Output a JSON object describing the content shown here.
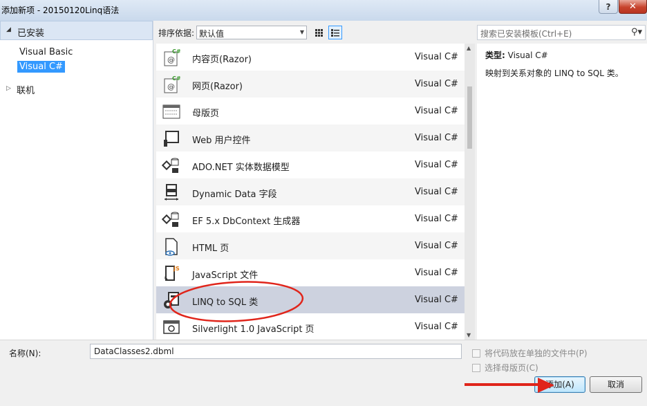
{
  "window": {
    "title": "添加新项 - 20150120Linq语法",
    "help": "?",
    "close": "✕"
  },
  "left": {
    "installed": "已安装",
    "items": [
      {
        "label": "Visual Basic"
      },
      {
        "label": "Visual C#",
        "selected": true
      }
    ],
    "online": "联机"
  },
  "toolbar": {
    "sort_label": "排序依据:",
    "sort_value": "默认值"
  },
  "search": {
    "placeholder": "搜索已安装模板(Ctrl+E)"
  },
  "templates": [
    {
      "name": "内容页(Razor)",
      "lang": "Visual C#",
      "icon": "razor-page-icon"
    },
    {
      "name": "网页(Razor)",
      "lang": "Visual C#",
      "icon": "razor-page-icon"
    },
    {
      "name": "母版页",
      "lang": "Visual C#",
      "icon": "master-page-icon"
    },
    {
      "name": "Web 用户控件",
      "lang": "Visual C#",
      "icon": "user-control-icon"
    },
    {
      "name": "ADO.NET 实体数据模型",
      "lang": "Visual C#",
      "icon": "entity-model-icon"
    },
    {
      "name": "Dynamic Data 字段",
      "lang": "Visual C#",
      "icon": "dynamic-data-icon"
    },
    {
      "name": "EF 5.x DbContext 生成器",
      "lang": "Visual C#",
      "icon": "entity-model-icon"
    },
    {
      "name": "HTML 页",
      "lang": "Visual C#",
      "icon": "html-page-icon"
    },
    {
      "name": "JavaScript 文件",
      "lang": "Visual C#",
      "icon": "javascript-file-icon"
    },
    {
      "name": "LINQ to SQL 类",
      "lang": "Visual C#",
      "icon": "linq-to-sql-icon",
      "selected": true
    },
    {
      "name": "Silverlight 1.0 JavaScript 页",
      "lang": "Visual C#",
      "icon": "silverlight-page-icon"
    }
  ],
  "details": {
    "type_label": "类型:",
    "type_value": "Visual C#",
    "description": "映射到关系对象的 LINQ to SQL 类。"
  },
  "bottom": {
    "name_label": "名称(N):",
    "name_value": "DataClasses2.dbml",
    "chk_separate": "将代码放在单独的文件中(P)",
    "chk_master": "选择母版页(C)",
    "add": "添加(A)",
    "cancel": "取消"
  },
  "colors": {
    "selection": "#3399ff",
    "selected_row": "#cdd2df",
    "annotation": "#e0251b"
  }
}
